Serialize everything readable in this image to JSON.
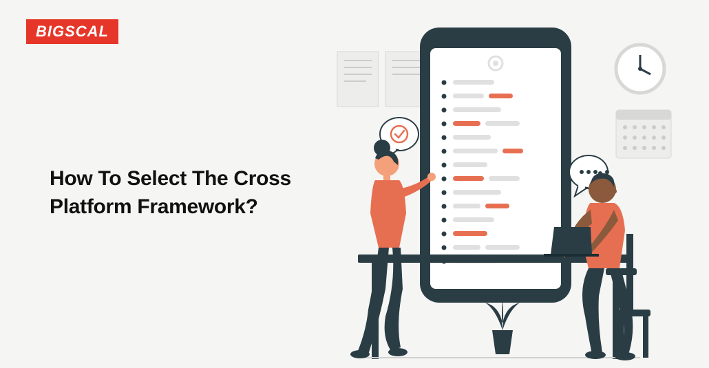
{
  "logo": {
    "text": "BIGSCAL"
  },
  "headline": {
    "line1": "How To Select The Cross",
    "line2": "Platform Framework?"
  },
  "illustration": {
    "description": "Two people collaborating at a desk with a large mobile phone mockup showing a list UI, a clock, calendar, plant, checkmark speech bubble and chat bubble"
  }
}
